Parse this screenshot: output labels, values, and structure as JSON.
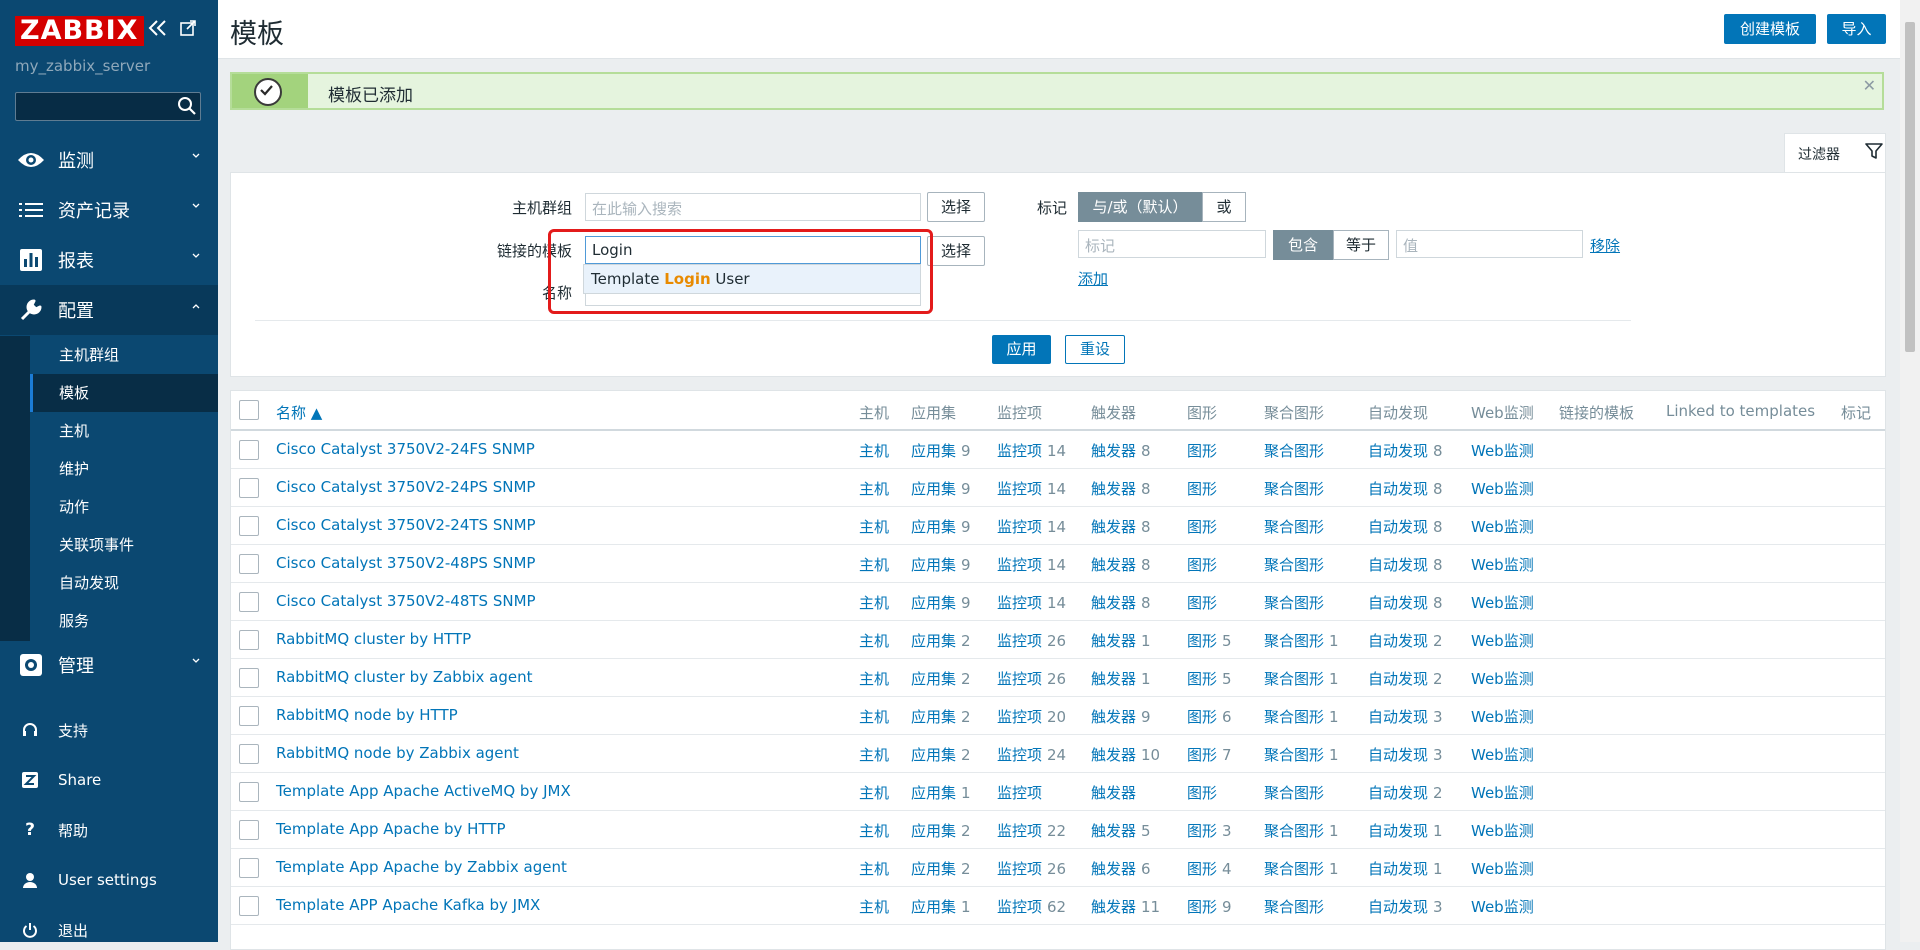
{
  "sidebar": {
    "logo": "ZABBIX",
    "server": "my_zabbix_server",
    "main_items": [
      {
        "label": "监测",
        "icon": "eye-icon"
      },
      {
        "label": "资产记录",
        "icon": "list-icon"
      },
      {
        "label": "报表",
        "icon": "bar-chart-icon"
      },
      {
        "label": "配置",
        "icon": "wrench-icon"
      },
      {
        "label": "管理",
        "icon": "gear-icon"
      }
    ],
    "sub_items": [
      "主机群组",
      "模板",
      "主机",
      "维护",
      "动作",
      "关联项事件",
      "自动发现",
      "服务"
    ],
    "util_items": [
      {
        "label": "支持",
        "icon": "headset-icon"
      },
      {
        "label": "Share",
        "icon": "zabbix-share-icon"
      },
      {
        "label": "帮助",
        "icon": "question-icon"
      },
      {
        "label": "User settings",
        "icon": "user-icon"
      },
      {
        "label": "退出",
        "icon": "power-icon"
      }
    ]
  },
  "header": {
    "title": "模板",
    "create_button": "创建模板",
    "import_button": "导入"
  },
  "message": {
    "text": "模板已添加"
  },
  "filter": {
    "tab_label": "过滤器",
    "host_group_label": "主机群组",
    "host_group_placeholder": "在此输入搜索",
    "select_button": "选择",
    "linked_templates_label": "链接的模板",
    "linked_templates_value": "Login",
    "name_label": "名称",
    "autocomplete": {
      "prefix": "Template ",
      "match": "Login",
      "suffix": " User"
    },
    "tags_label": "标记",
    "and_or": "与/或（默认）",
    "or": "或",
    "tag_placeholder": "标记",
    "contains": "包含",
    "equals": "等于",
    "value_placeholder": "值",
    "remove": "移除",
    "add": "添加",
    "apply": "应用",
    "reset": "重设"
  },
  "table": {
    "headers": {
      "name": "名称 ▲",
      "hosts": "主机",
      "applications": "应用集",
      "items": "监控项",
      "triggers": "触发器",
      "graphs": "图形",
      "screens": "聚合图形",
      "discovery": "自动发现",
      "web": "Web监测",
      "linked": "链接的模板",
      "linked_to": "Linked to templates",
      "tags": "标记"
    },
    "rows": [
      {
        "name": "Cisco Catalyst 3750V2-24FS SNMP",
        "hosts": "主机",
        "app": "应用集",
        "app_n": "9",
        "items": "监控项",
        "items_n": "14",
        "trig": "触发器",
        "trig_n": "8",
        "graphs": "图形",
        "graphs_n": "",
        "screens": "聚合图形",
        "screens_n": "",
        "disc": "自动发现",
        "disc_n": "8",
        "web": "Web监测"
      },
      {
        "name": "Cisco Catalyst 3750V2-24PS SNMP",
        "hosts": "主机",
        "app": "应用集",
        "app_n": "9",
        "items": "监控项",
        "items_n": "14",
        "trig": "触发器",
        "trig_n": "8",
        "graphs": "图形",
        "graphs_n": "",
        "screens": "聚合图形",
        "screens_n": "",
        "disc": "自动发现",
        "disc_n": "8",
        "web": "Web监测"
      },
      {
        "name": "Cisco Catalyst 3750V2-24TS SNMP",
        "hosts": "主机",
        "app": "应用集",
        "app_n": "9",
        "items": "监控项",
        "items_n": "14",
        "trig": "触发器",
        "trig_n": "8",
        "graphs": "图形",
        "graphs_n": "",
        "screens": "聚合图形",
        "screens_n": "",
        "disc": "自动发现",
        "disc_n": "8",
        "web": "Web监测"
      },
      {
        "name": "Cisco Catalyst 3750V2-48PS SNMP",
        "hosts": "主机",
        "app": "应用集",
        "app_n": "9",
        "items": "监控项",
        "items_n": "14",
        "trig": "触发器",
        "trig_n": "8",
        "graphs": "图形",
        "graphs_n": "",
        "screens": "聚合图形",
        "screens_n": "",
        "disc": "自动发现",
        "disc_n": "8",
        "web": "Web监测"
      },
      {
        "name": "Cisco Catalyst 3750V2-48TS SNMP",
        "hosts": "主机",
        "app": "应用集",
        "app_n": "9",
        "items": "监控项",
        "items_n": "14",
        "trig": "触发器",
        "trig_n": "8",
        "graphs": "图形",
        "graphs_n": "",
        "screens": "聚合图形",
        "screens_n": "",
        "disc": "自动发现",
        "disc_n": "8",
        "web": "Web监测"
      },
      {
        "name": "RabbitMQ cluster by HTTP",
        "hosts": "主机",
        "app": "应用集",
        "app_n": "2",
        "items": "监控项",
        "items_n": "26",
        "trig": "触发器",
        "trig_n": "1",
        "graphs": "图形",
        "graphs_n": "5",
        "screens": "聚合图形",
        "screens_n": "1",
        "disc": "自动发现",
        "disc_n": "2",
        "web": "Web监测"
      },
      {
        "name": "RabbitMQ cluster by Zabbix agent",
        "hosts": "主机",
        "app": "应用集",
        "app_n": "2",
        "items": "监控项",
        "items_n": "26",
        "trig": "触发器",
        "trig_n": "1",
        "graphs": "图形",
        "graphs_n": "5",
        "screens": "聚合图形",
        "screens_n": "1",
        "disc": "自动发现",
        "disc_n": "2",
        "web": "Web监测"
      },
      {
        "name": "RabbitMQ node by HTTP",
        "hosts": "主机",
        "app": "应用集",
        "app_n": "2",
        "items": "监控项",
        "items_n": "20",
        "trig": "触发器",
        "trig_n": "9",
        "graphs": "图形",
        "graphs_n": "6",
        "screens": "聚合图形",
        "screens_n": "1",
        "disc": "自动发现",
        "disc_n": "3",
        "web": "Web监测"
      },
      {
        "name": "RabbitMQ node by Zabbix agent",
        "hosts": "主机",
        "app": "应用集",
        "app_n": "2",
        "items": "监控项",
        "items_n": "24",
        "trig": "触发器",
        "trig_n": "10",
        "graphs": "图形",
        "graphs_n": "7",
        "screens": "聚合图形",
        "screens_n": "1",
        "disc": "自动发现",
        "disc_n": "3",
        "web": "Web监测"
      },
      {
        "name": "Template App Apache ActiveMQ by JMX",
        "hosts": "主机",
        "app": "应用集",
        "app_n": "1",
        "items": "监控项",
        "items_n": "",
        "trig": "触发器",
        "trig_n": "",
        "graphs": "图形",
        "graphs_n": "",
        "screens": "聚合图形",
        "screens_n": "",
        "disc": "自动发现",
        "disc_n": "2",
        "web": "Web监测"
      },
      {
        "name": "Template App Apache by HTTP",
        "hosts": "主机",
        "app": "应用集",
        "app_n": "2",
        "items": "监控项",
        "items_n": "22",
        "trig": "触发器",
        "trig_n": "5",
        "graphs": "图形",
        "graphs_n": "3",
        "screens": "聚合图形",
        "screens_n": "1",
        "disc": "自动发现",
        "disc_n": "1",
        "web": "Web监测"
      },
      {
        "name": "Template App Apache by Zabbix agent",
        "hosts": "主机",
        "app": "应用集",
        "app_n": "2",
        "items": "监控项",
        "items_n": "26",
        "trig": "触发器",
        "trig_n": "6",
        "graphs": "图形",
        "graphs_n": "4",
        "screens": "聚合图形",
        "screens_n": "1",
        "disc": "自动发现",
        "disc_n": "1",
        "web": "Web监测"
      },
      {
        "name": "Template APP Apache Kafka by JMX",
        "hosts": "主机",
        "app": "应用集",
        "app_n": "1",
        "items": "监控项",
        "items_n": "62",
        "trig": "触发器",
        "trig_n": "11",
        "graphs": "图形",
        "graphs_n": "9",
        "screens": "聚合图形",
        "screens_n": "",
        "disc": "自动发现",
        "disc_n": "3",
        "web": "Web监测"
      }
    ]
  }
}
